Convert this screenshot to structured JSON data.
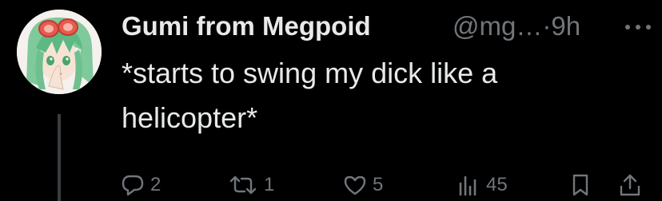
{
  "tweet": {
    "author": {
      "display_name": "Gumi from Megpoid",
      "handle": "@mg…",
      "separator": "·",
      "time": "9h",
      "avatar_icon": "anime-character-avatar"
    },
    "text": "*starts to swing my dick like a helicopter*",
    "more_icon": "more-horizontal-icon",
    "actions": {
      "replies": {
        "icon": "reply-icon",
        "count": "2"
      },
      "reposts": {
        "icon": "repost-icon",
        "count": "1"
      },
      "likes": {
        "icon": "like-icon",
        "count": "5"
      },
      "views": {
        "icon": "views-icon",
        "count": "45"
      },
      "bookmark": {
        "icon": "bookmark-icon"
      },
      "share": {
        "icon": "share-icon"
      }
    }
  },
  "colors": {
    "background": "#000000",
    "primary_text": "#e7e9ea",
    "secondary_text": "#71767b",
    "thread_line": "#3a3d40"
  }
}
